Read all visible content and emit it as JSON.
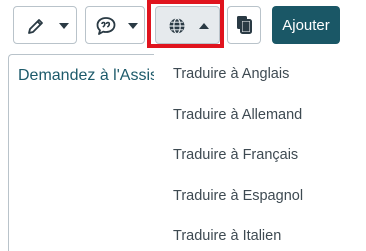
{
  "toolbar": {
    "edit_icon": "pencil-icon",
    "comment_icon": "speech-bubble-icon",
    "translate_icon": "globe-icon",
    "copy_icon": "copy-icon",
    "add_label": "Ajouter"
  },
  "input": {
    "placeholder_text": "Demandez à l'Assistant"
  },
  "translate_menu": {
    "items": [
      {
        "label": "Traduire à Anglais"
      },
      {
        "label": "Traduire à Allemand"
      },
      {
        "label": "Traduire à Français"
      },
      {
        "label": "Traduire à Espagnol"
      },
      {
        "label": "Traduire à Italien"
      }
    ]
  },
  "colors": {
    "accent": "#1a5766",
    "highlight": "#e0141e",
    "border": "#b9c3ca",
    "text_teal": "#1d5a6a"
  }
}
